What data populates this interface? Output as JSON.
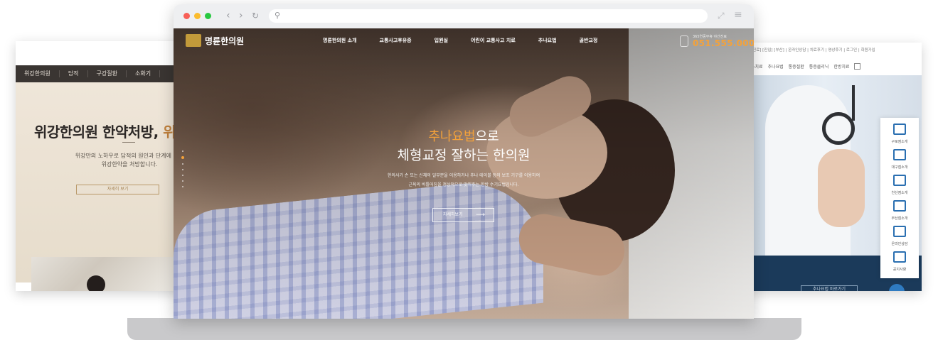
{
  "browser": {
    "address_placeholder": "",
    "traffic_light_colors": [
      "#f75f57",
      "#fbbc2e",
      "#28c840"
    ]
  },
  "left_card": {
    "nav": [
      "위강한의원",
      "담적",
      "구강질환",
      "소화기"
    ],
    "title_main": "위강한의원 한약처방, ",
    "title_highlight": "위",
    "desc_line1": "위강만의 노하우로 담적의 원인과 단계에 따른",
    "desc_line2": "위강한약을 처방합니다.",
    "more_button": "자세히 보기"
  },
  "right_card": {
    "utility": "[진료] [진입] [부산] | 온라인상담 | 치료후기 | 영상후기 | 로그인 | 회원가입",
    "menu": [
      "소치료",
      "추나요법",
      "통증질환",
      "통증클리닉",
      "한방치료"
    ],
    "quick_menu": [
      {
        "label": "구로점소개",
        "icon": "building-icon"
      },
      {
        "label": "대구점소개",
        "icon": "building-icon"
      },
      {
        "label": "천산점소개",
        "icon": "building-icon"
      },
      {
        "label": "부산점소개",
        "icon": "building-icon"
      },
      {
        "label": "온라인상담",
        "icon": "monitor-icon"
      },
      {
        "label": "공지사항",
        "icon": "megaphone-icon"
      }
    ],
    "bottom_button": "추나요법 바로가기"
  },
  "site": {
    "logo_text": "명륜한의원",
    "gnb": [
      "명륜한의원 소개",
      "교통사고후유증",
      "입원실",
      "어린이 교통사고 치료",
      "추나요법",
      "골반교정"
    ],
    "phone_caption": "365연중무휴 야간진료",
    "phone_number": "051.555.0008",
    "hero": {
      "line1_highlight": "추나요법",
      "line1_rest": "으로",
      "line2": "체형교정 잘하는 한의원",
      "desc1": "한의사가 손 또는 신체의 일부분을 이용하거나 추나 테이블 등의 보조 기구를 이용하여",
      "desc2": "근육의 비틀어짐을 정상적으로 맞춰주는 한방 수기요법입니다.",
      "button": "자세히보기",
      "button_arrow": "⟶"
    },
    "pager_count": 7,
    "pager_active": 1
  },
  "colors": {
    "accent": "#f4a23a",
    "left_accent": "#c0813d"
  }
}
